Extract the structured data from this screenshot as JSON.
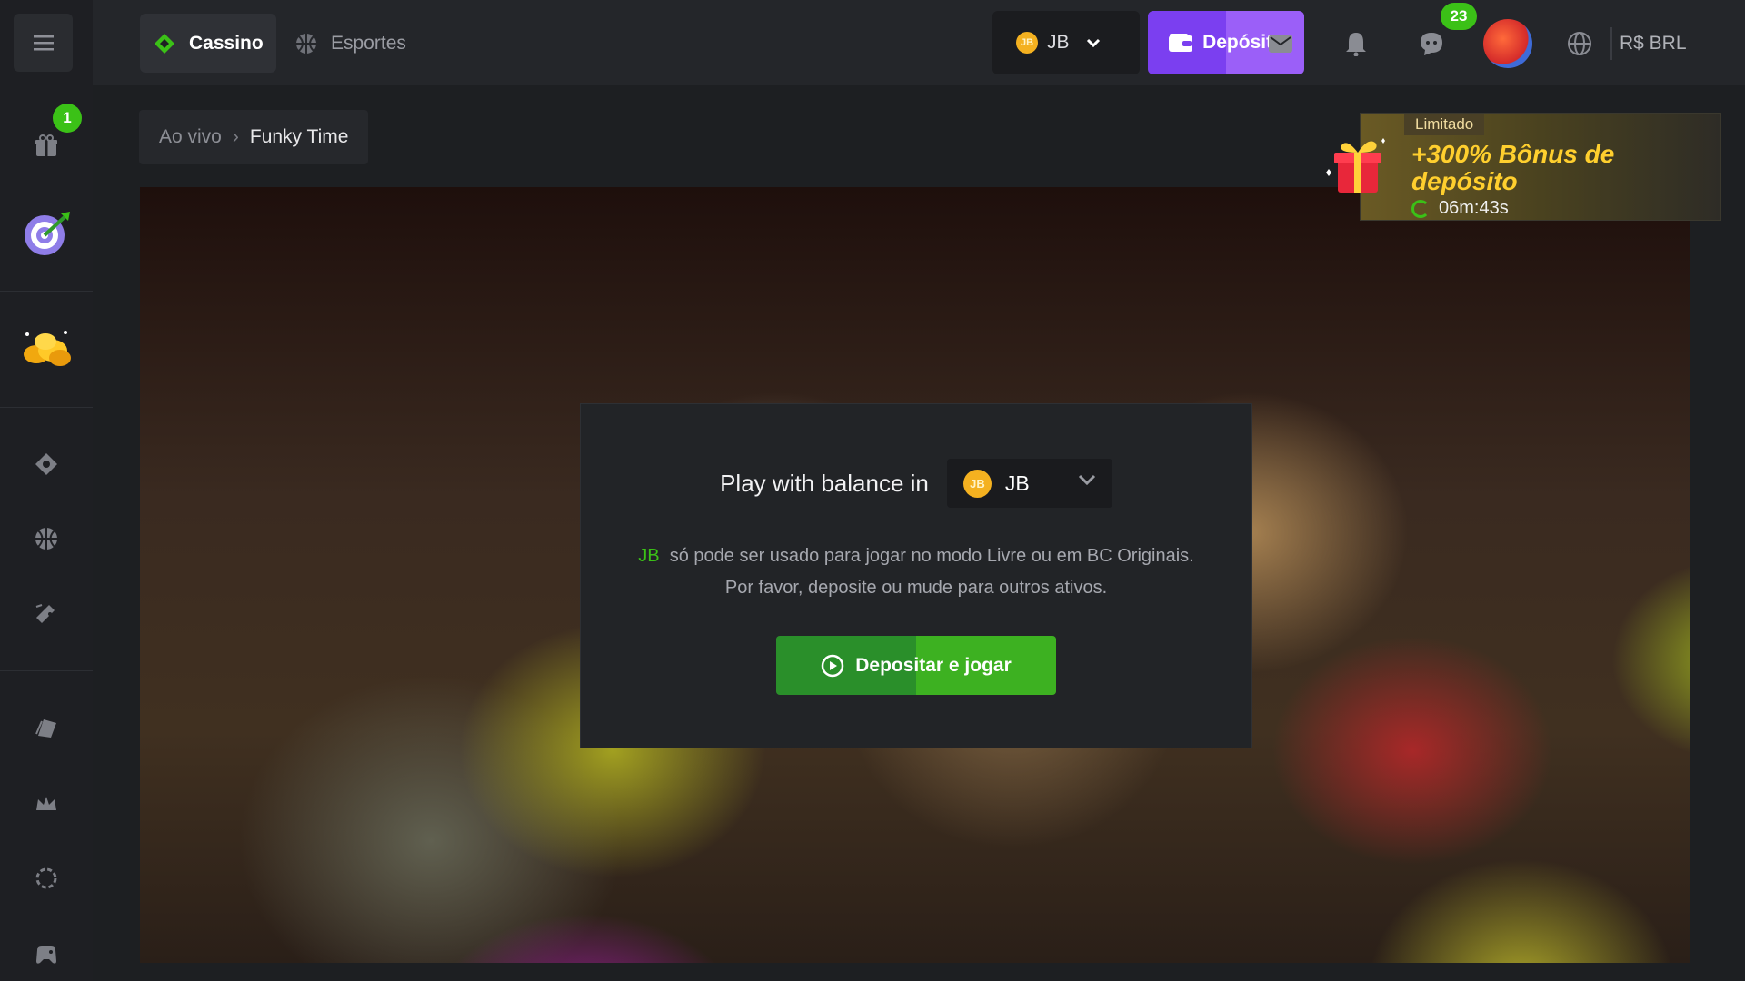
{
  "sidebar": {
    "menu_icon": "hamburger-icon",
    "bonus_badge": "1",
    "items": [
      {
        "name": "gift-icon"
      },
      {
        "name": "target-icon"
      },
      {
        "name": "coins-icon"
      },
      {
        "name": "casino-icon"
      },
      {
        "name": "sports-icon"
      },
      {
        "name": "ticket-icon"
      },
      {
        "name": "card-icon"
      },
      {
        "name": "crown-icon"
      },
      {
        "name": "settings-icon"
      },
      {
        "name": "gamepad-icon"
      }
    ]
  },
  "topbar": {
    "tabs": [
      {
        "label": "Cassino",
        "active": true
      },
      {
        "label": "Esportes",
        "active": false
      }
    ],
    "currency": {
      "coin_label": "JB",
      "code": "JB"
    },
    "deposit_label": "Depósito",
    "chat_badge": "23",
    "language_label": "R$ BRL"
  },
  "breadcrumb": {
    "prev": "Ao vivo",
    "current": "Funky Time"
  },
  "promo": {
    "tag": "Limitado",
    "title": "+300% Bônus de depósito",
    "timer": "06m:43s"
  },
  "modal": {
    "heading": "Play with balance in",
    "select": {
      "coin_label": "JB",
      "value": "JB"
    },
    "notice_highlight": "JB",
    "notice_text": "só pode ser usado para jogar no modo Livre ou em BC Originais. Por favor, deposite ou mude para outros ativos.",
    "button_label": "Depositar e jogar"
  },
  "colors": {
    "accent_green": "#3bc117",
    "deposit_purple": "#7b3ff0",
    "promo_gold": "#ffcf2e"
  }
}
